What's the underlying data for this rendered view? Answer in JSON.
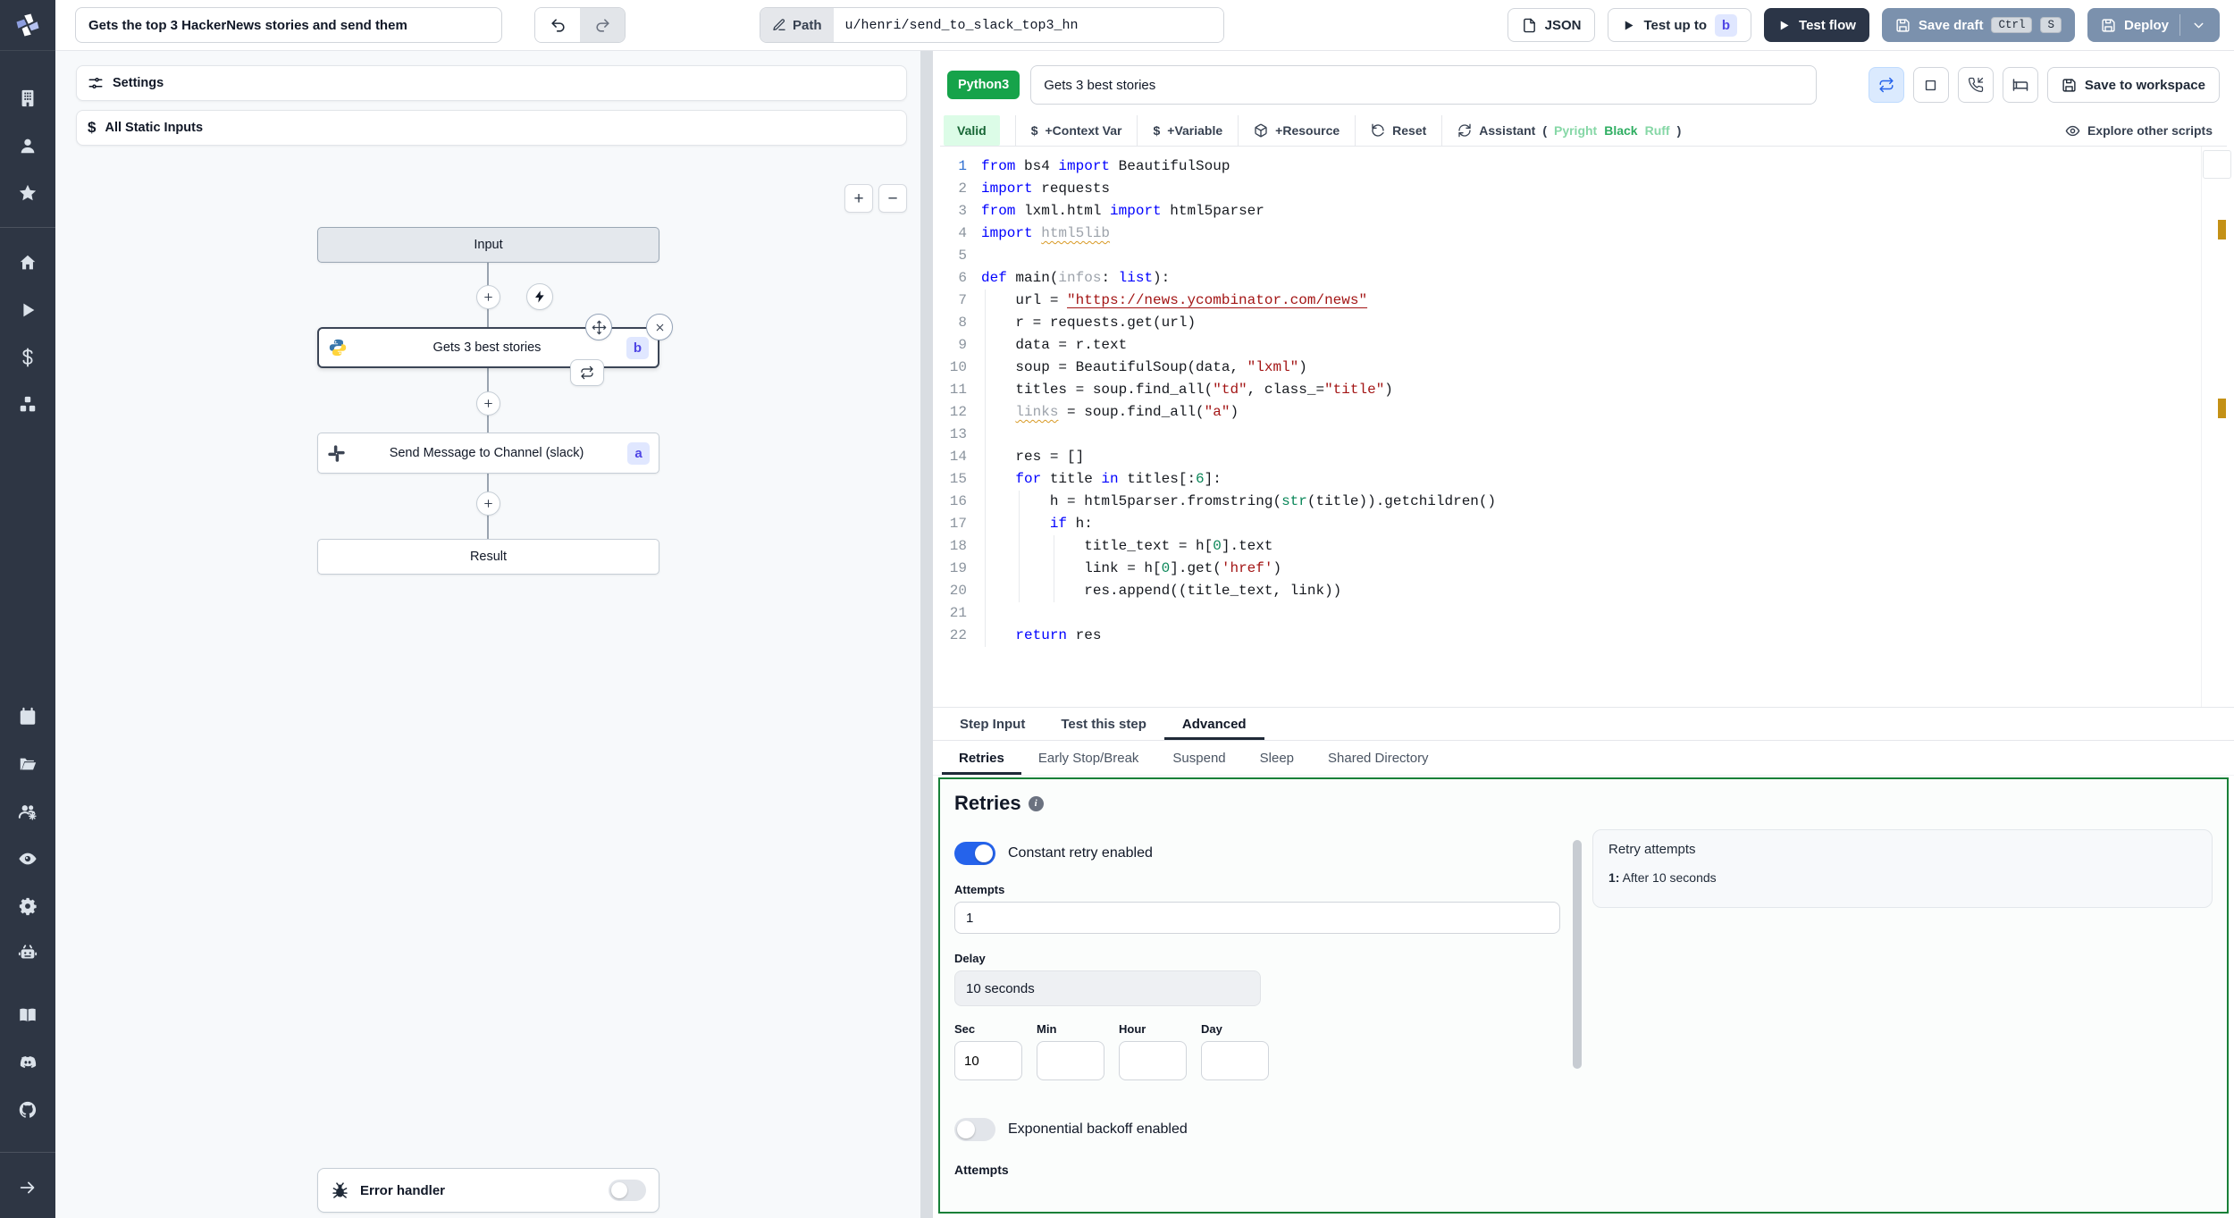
{
  "topbar": {
    "flow_title": "Gets the top 3 HackerNews stories and send them",
    "path_label": "Path",
    "path_value": "u/henri/send_to_slack_top3_hn",
    "json_label": "JSON",
    "test_up_to_label": "Test up to",
    "test_up_to_badge": "b",
    "test_flow_label": "Test flow",
    "save_draft_label": "Save draft",
    "kbd_ctrl": "Ctrl",
    "kbd_s": "S",
    "deploy_label": "Deploy"
  },
  "sidebar": {
    "groups": [
      [
        "building",
        "user",
        "star"
      ],
      [
        "home",
        "play",
        "dollar",
        "cubes"
      ],
      [
        "calendar",
        "folder",
        "user-group",
        "eye",
        "gear",
        "robot"
      ],
      [
        "book",
        "discord",
        "github"
      ]
    ],
    "bottom": "arrow-right"
  },
  "flow": {
    "settings_label": "Settings",
    "static_inputs_label": "All Static Inputs",
    "zoom_in": "+",
    "zoom_out": "−",
    "input_node": "Input",
    "step_b_label": "Gets 3 best stories",
    "step_b_badge": "b",
    "step_a_label": "Send Message to Channel (slack)",
    "step_a_badge": "a",
    "result_node": "Result",
    "error_handler_label": "Error handler"
  },
  "editor": {
    "language_badge": "Python3",
    "title_value": "Gets 3 best stories",
    "save_to_workspace": "Save to workspace",
    "valid_label": "Valid",
    "context_var_label": "+Context Var",
    "variable_label": "+Variable",
    "resource_label": "+Resource",
    "reset_label": "Reset",
    "assistant_label": "Assistant",
    "assistant_open": "(",
    "assistant_pyright": "Pyright",
    "assistant_black": "Black",
    "assistant_ruff": "Ruff",
    "assistant_close": ")",
    "explore_label": "Explore other scripts",
    "code": [
      {
        "n": 1,
        "gd": 0,
        "s": [
          [
            "k",
            "from "
          ],
          [
            "d",
            "bs4 "
          ],
          [
            "k",
            "import "
          ],
          [
            "d",
            "BeautifulSoup"
          ]
        ]
      },
      {
        "n": 2,
        "gd": 0,
        "s": [
          [
            "k",
            "import "
          ],
          [
            "d",
            "requests"
          ]
        ]
      },
      {
        "n": 3,
        "gd": 0,
        "s": [
          [
            "k",
            "from "
          ],
          [
            "d",
            "lxml.html "
          ],
          [
            "k",
            "import "
          ],
          [
            "d",
            "html5parser"
          ]
        ]
      },
      {
        "n": 4,
        "gd": 0,
        "s": [
          [
            "k",
            "import "
          ],
          [
            "w",
            "html5lib"
          ]
        ]
      },
      {
        "n": 5,
        "gd": 0,
        "s": []
      },
      {
        "n": 6,
        "gd": 0,
        "s": [
          [
            "k",
            "def "
          ],
          [
            "d",
            "main("
          ],
          [
            "gy",
            "infos"
          ],
          [
            "d",
            ": "
          ],
          [
            "k",
            "list"
          ],
          [
            "d",
            "):"
          ]
        ]
      },
      {
        "n": 7,
        "gd": 1,
        "s": [
          [
            "d",
            "    url = "
          ],
          [
            "su",
            "\"https://news.ycombinator.com/news\""
          ]
        ]
      },
      {
        "n": 8,
        "gd": 1,
        "s": [
          [
            "d",
            "    r = requests.get(url)"
          ]
        ]
      },
      {
        "n": 9,
        "gd": 1,
        "s": [
          [
            "d",
            "    data = r.text"
          ]
        ]
      },
      {
        "n": 10,
        "gd": 1,
        "s": [
          [
            "d",
            "    soup = BeautifulSoup(data, "
          ],
          [
            "s",
            "\"lxml\""
          ],
          [
            "d",
            ")"
          ]
        ]
      },
      {
        "n": 11,
        "gd": 1,
        "s": [
          [
            "d",
            "    titles = soup.find_all("
          ],
          [
            "s",
            "\"td\""
          ],
          [
            "d",
            ", class_="
          ],
          [
            "s",
            "\"title\""
          ],
          [
            "d",
            ")"
          ]
        ]
      },
      {
        "n": 12,
        "gd": 1,
        "s": [
          [
            "d",
            "    "
          ],
          [
            "w",
            "links"
          ],
          [
            "d",
            " = soup.find_all("
          ],
          [
            "s",
            "\"a\""
          ],
          [
            "d",
            ")"
          ]
        ]
      },
      {
        "n": 13,
        "gd": 1,
        "s": []
      },
      {
        "n": 14,
        "gd": 1,
        "s": [
          [
            "d",
            "    res = []"
          ]
        ]
      },
      {
        "n": 15,
        "gd": 1,
        "s": [
          [
            "d",
            "    "
          ],
          [
            "k",
            "for "
          ],
          [
            "d",
            "title "
          ],
          [
            "k",
            "in "
          ],
          [
            "d",
            "titles[:"
          ],
          [
            "n2",
            "6"
          ],
          [
            "d",
            "]:"
          ]
        ]
      },
      {
        "n": 16,
        "gd": 2,
        "s": [
          [
            "d",
            "        h = html5parser.fromstring("
          ],
          [
            "fn",
            "str"
          ],
          [
            "d",
            "(title)).getchildren()"
          ]
        ]
      },
      {
        "n": 17,
        "gd": 2,
        "s": [
          [
            "d",
            "        "
          ],
          [
            "k",
            "if "
          ],
          [
            "d",
            "h:"
          ]
        ]
      },
      {
        "n": 18,
        "gd": 3,
        "s": [
          [
            "d",
            "            title_text = h["
          ],
          [
            "n2",
            "0"
          ],
          [
            "d",
            "].text"
          ]
        ]
      },
      {
        "n": 19,
        "gd": 3,
        "s": [
          [
            "d",
            "            link = h["
          ],
          [
            "n2",
            "0"
          ],
          [
            "d",
            "].get("
          ],
          [
            "s",
            "'href'"
          ],
          [
            "d",
            ")"
          ]
        ]
      },
      {
        "n": 20,
        "gd": 3,
        "s": [
          [
            "d",
            "            res.append((title_text, link))"
          ]
        ]
      },
      {
        "n": 21,
        "gd": 1,
        "s": []
      },
      {
        "n": 22,
        "gd": 1,
        "s": [
          [
            "d",
            "    "
          ],
          [
            "k",
            "return "
          ],
          [
            "d",
            "res"
          ]
        ]
      }
    ]
  },
  "panel": {
    "tabs": [
      "Step Input",
      "Test this step",
      "Advanced"
    ],
    "subtabs": [
      "Retries",
      "Early Stop/Break",
      "Suspend",
      "Sleep",
      "Shared Directory"
    ],
    "retries": {
      "title": "Retries",
      "constant_label": "Constant retry enabled",
      "attempts_label": "Attempts",
      "attempts_value": "1",
      "delay_label": "Delay",
      "delay_value": "10 seconds",
      "units": [
        "Sec",
        "Min",
        "Hour",
        "Day"
      ],
      "sec_value": "10",
      "exponential_label": "Exponential backoff enabled",
      "attempts2_label": "Attempts",
      "summary_title": "Retry attempts",
      "summary_prefix": "1:",
      "summary_text": "After 10 seconds"
    }
  },
  "colors": {
    "sidebar_bg": "#2e3644",
    "accent_blue": "#2563eb",
    "lang_green": "#16a34a",
    "panel_green_border": "#188038",
    "warning_amber": "#c49116",
    "badge_bg": "#e0e7ff",
    "badge_text": "#4f46e5"
  }
}
